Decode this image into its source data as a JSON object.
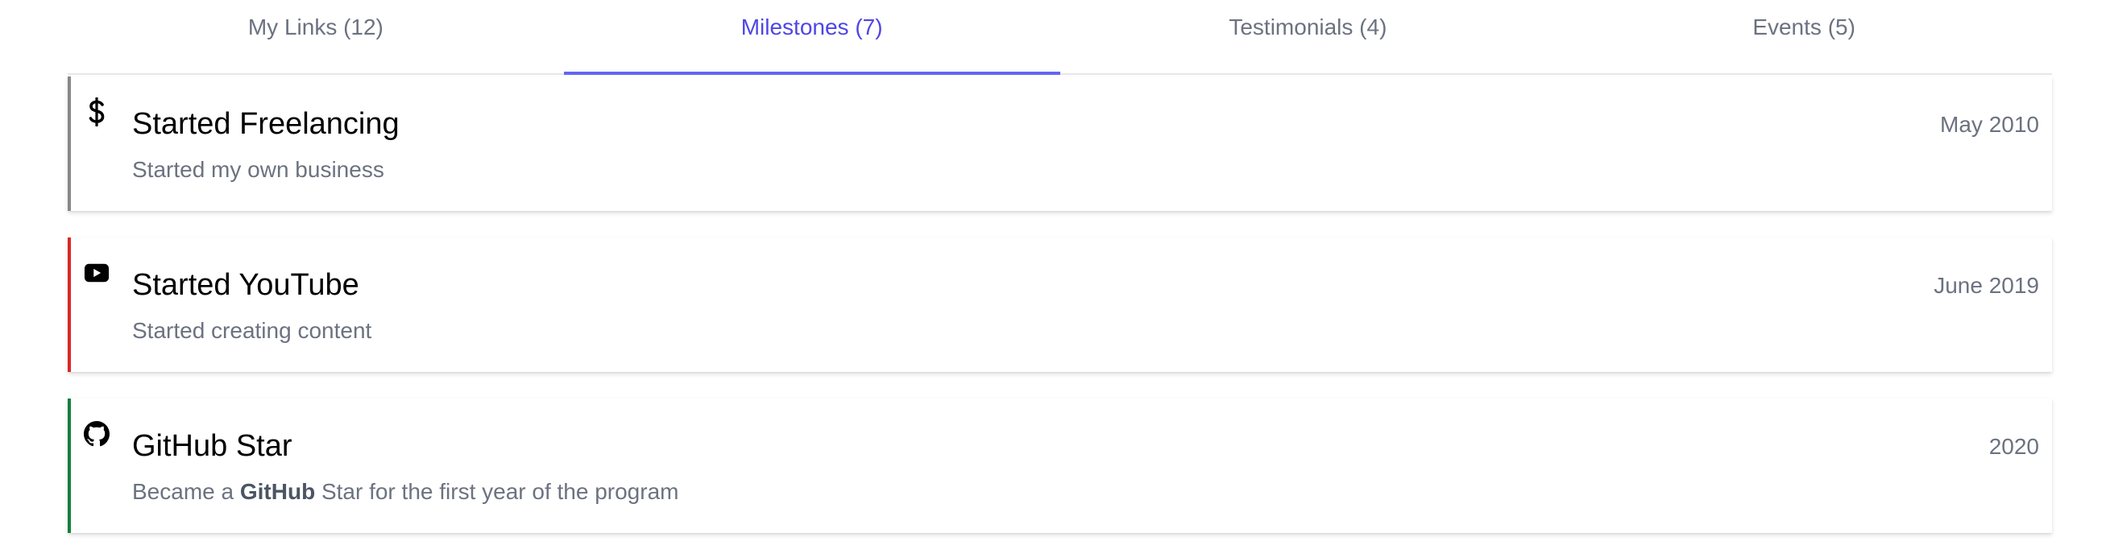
{
  "tabs": [
    {
      "label": "My Links (12)",
      "active": false
    },
    {
      "label": "Milestones (7)",
      "active": true
    },
    {
      "label": "Testimonials (4)",
      "active": false
    },
    {
      "label": "Events (5)",
      "active": false
    }
  ],
  "colors": {
    "accent": "#4f46e5",
    "accent_underline": "#6366f1",
    "milestone_freelancing_border": "#888888",
    "milestone_youtube_border": "#dc2626",
    "milestone_github_border": "#15803d"
  },
  "milestones": [
    {
      "icon": "dollar-icon",
      "title": "Started Freelancing",
      "description": "Started my own business",
      "date": "May 2010"
    },
    {
      "icon": "youtube-icon",
      "title": "Started YouTube",
      "description": "Started creating content",
      "date": "June 2019"
    },
    {
      "icon": "github-icon",
      "title": "GitHub Star",
      "description_prefix": "Became a ",
      "description_bold": "GitHub",
      "description_suffix": " Star for the first year of the program",
      "date": "2020"
    }
  ]
}
